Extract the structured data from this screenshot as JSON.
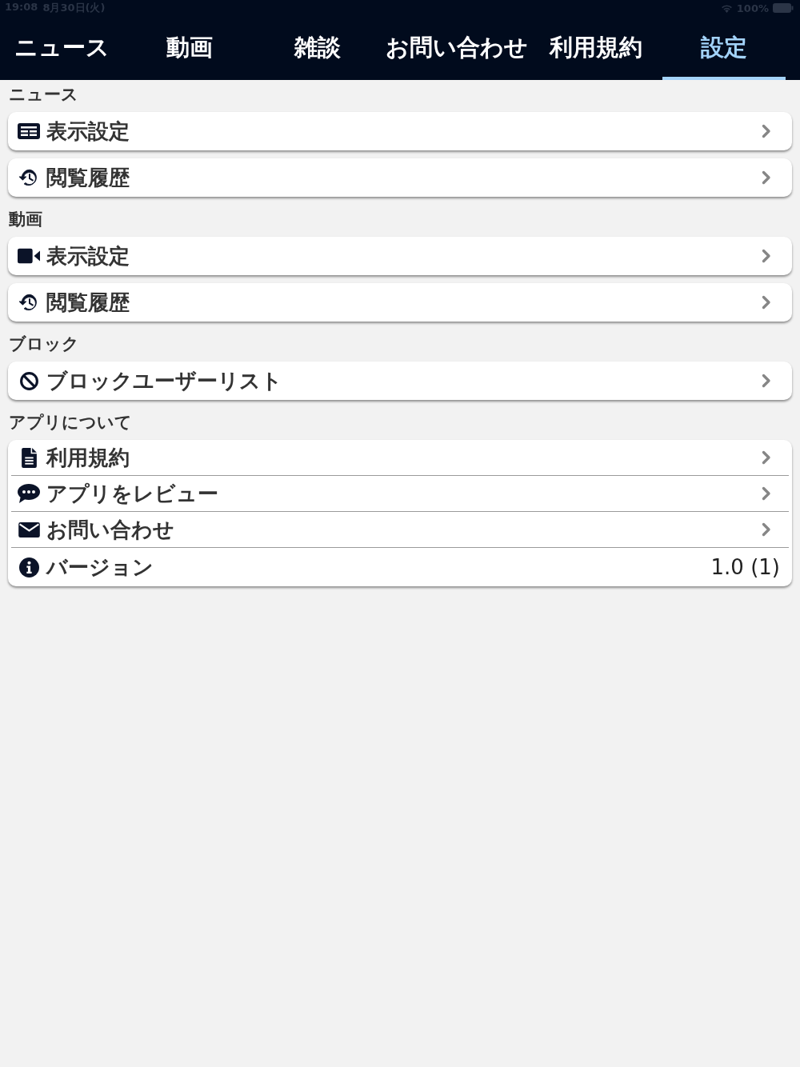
{
  "status_bar": {
    "time": "19:08",
    "date": "8月30日(火)",
    "battery": "100%"
  },
  "tabs": [
    {
      "label": "ニュース",
      "selected": false
    },
    {
      "label": "動画",
      "selected": false
    },
    {
      "label": "雑談",
      "selected": false
    },
    {
      "label": "お問い合わせ",
      "selected": false
    },
    {
      "label": "利用規約",
      "selected": false
    },
    {
      "label": "設定",
      "selected": true
    }
  ],
  "sections": [
    {
      "title": "ニュース",
      "kind": "cards",
      "items": [
        {
          "label": "表示設定",
          "kind": "link"
        },
        {
          "label": "閲覧履歴",
          "kind": "link"
        }
      ]
    },
    {
      "title": "動画",
      "kind": "cards",
      "items": [
        {
          "label": "表示設定",
          "kind": "link"
        },
        {
          "label": "閲覧履歴",
          "kind": "link"
        }
      ]
    },
    {
      "title": "ブロック",
      "kind": "cards",
      "items": [
        {
          "label": "ブロックユーザーリスト",
          "kind": "link"
        }
      ]
    },
    {
      "title": "アプリについて",
      "kind": "group",
      "items": [
        {
          "label": "利用規約",
          "kind": "link"
        },
        {
          "label": "アプリをレビュー",
          "kind": "link"
        },
        {
          "label": "お問い合わせ",
          "kind": "link"
        },
        {
          "label": "バージョン",
          "kind": "value",
          "value": "1.0 (1)"
        }
      ]
    }
  ]
}
